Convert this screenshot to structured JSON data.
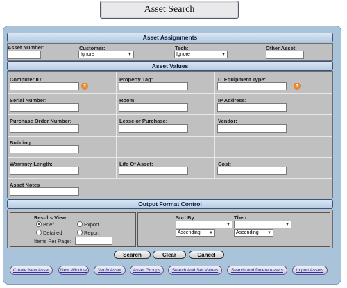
{
  "title": "Asset Search",
  "sections": {
    "assignments": "Asset Assignments",
    "values": "Asset Values",
    "output": "Output Format Control"
  },
  "assignments": {
    "asset_number_label": "Asset Number:",
    "asset_number_value": "",
    "customer_label": "Customer:",
    "customer_value": "Ignore",
    "tech_label": "Tech:",
    "tech_value": "Ignore",
    "other_asset_label": "Other Asset:",
    "other_asset_value": ""
  },
  "values": {
    "computer_id": "Computer ID:",
    "property_tag": "Property Tag:",
    "it_equipment_type": "IT Equipment Type:",
    "serial_number": "Serial Number:",
    "room": "Room:",
    "ip_address": "IP Address:",
    "purchase_order_number": "Purchase Order Number:",
    "lease_or_purchase": "Lease or Purchase:",
    "vendor": "Vendor:",
    "building": "Building:",
    "warranty_length": "Warranty Length:",
    "life_of_asset": "Life Of Asset:",
    "cost": "Cost:",
    "asset_notes": "Asset Notes",
    "help_glyph": "?"
  },
  "output": {
    "results_view_label": "Results View:",
    "brief": "Brief",
    "export": "Export",
    "detailed": "Detailed",
    "report": "Report",
    "items_per_page": "Items Per Page:",
    "sort_by_label": "Sort By:",
    "then_label": "Then:",
    "sort_by_value": "",
    "then_value": "",
    "sort_order_1": "Ascending",
    "sort_order_2": "Ascending",
    "selected_view": "Brief"
  },
  "buttons": {
    "search": "Search",
    "clear": "Clear",
    "cancel": "Cancel"
  },
  "nav": [
    "Create New Asset",
    "New Window",
    "Verify Asset",
    "Asset Groups",
    "Search And Set Values",
    "Search and Delete Assets",
    "Import Assets"
  ],
  "colors": {
    "frame": "#a8c3da",
    "panel": "#c0c0c0",
    "link": "#2a2ab0",
    "help_icon": "#e07b1c"
  }
}
